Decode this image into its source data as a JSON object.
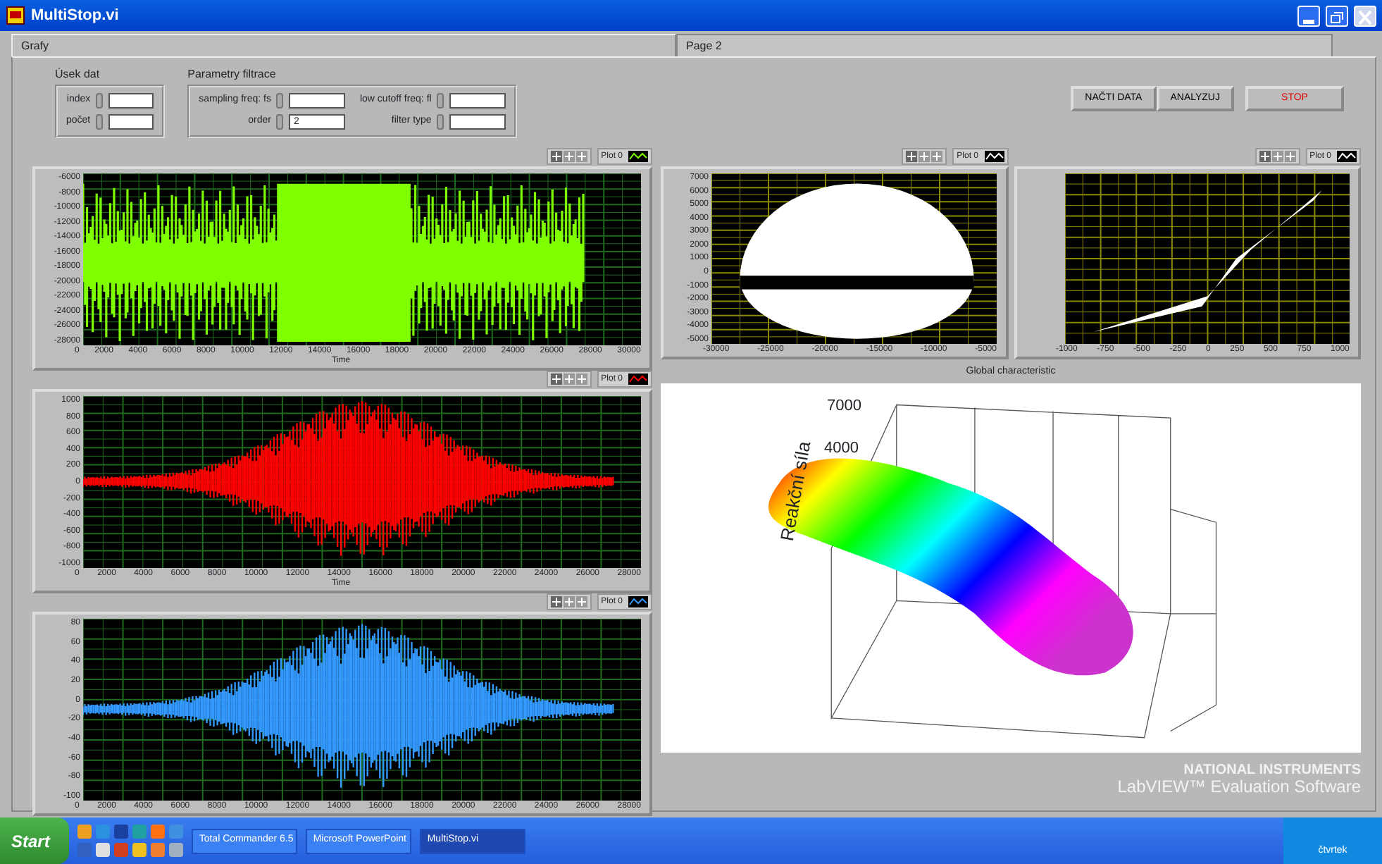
{
  "window": {
    "title": "MultiStop.vi"
  },
  "tabs": [
    {
      "label": "Grafy",
      "selected": true
    },
    {
      "label": "Page 2",
      "selected": false
    }
  ],
  "data_range": {
    "title": "Úsek dat",
    "fields": [
      {
        "label": "index"
      },
      {
        "label": "počet"
      }
    ]
  },
  "filter_params": {
    "title": "Parametry filtrace",
    "fields": [
      {
        "label": "sampling freq: fs"
      },
      {
        "label": "low cutoff freq: fl"
      },
      {
        "label": "order",
        "value": "2"
      },
      {
        "label": "filter type"
      }
    ]
  },
  "buttons": [
    {
      "label": "NAČTI DATA",
      "kind": "normal"
    },
    {
      "label": "ANALYZUJ",
      "kind": "normal"
    },
    {
      "label": "STOP",
      "kind": "stop"
    }
  ],
  "waveform_graphs": [
    {
      "legend": "Plot 0",
      "color": "#80ff00",
      "kind": "dense",
      "xlabel": "Time",
      "y_ticks": [
        "-6000",
        "-8000",
        "-10000",
        "-12000",
        "-14000",
        "-16000",
        "-18000",
        "-20000",
        "-22000",
        "-24000",
        "-26000",
        "-28000"
      ],
      "x_ticks": [
        "0",
        "2000",
        "4000",
        "6000",
        "8000",
        "10000",
        "12000",
        "14000",
        "16000",
        "18000",
        "20000",
        "22000",
        "24000",
        "26000",
        "28000",
        "30000"
      ]
    },
    {
      "legend": "Plot 0",
      "color": "#ff0000",
      "kind": "burst",
      "xlabel": "Time",
      "y_ticks": [
        "1000",
        "800",
        "600",
        "400",
        "200",
        "0",
        "-200",
        "-400",
        "-600",
        "-800",
        "-1000"
      ],
      "x_ticks": [
        "0",
        "2000",
        "4000",
        "6000",
        "8000",
        "10000",
        "12000",
        "14000",
        "16000",
        "18000",
        "20000",
        "22000",
        "24000",
        "26000",
        "28000"
      ]
    },
    {
      "legend": "Plot 0",
      "color": "#3399ff",
      "kind": "burst",
      "y_ticks": [
        "80",
        "60",
        "40",
        "20",
        "0",
        "-20",
        "-40",
        "-60",
        "-80",
        "-100"
      ],
      "x_ticks": [
        "0",
        "2000",
        "4000",
        "6000",
        "8000",
        "10000",
        "12000",
        "14000",
        "16000",
        "18000",
        "20000",
        "22000",
        "24000",
        "26000",
        "28000"
      ]
    }
  ],
  "xy_graphs": [
    {
      "legend": "Plot 0",
      "color": "#ffffff",
      "kind": "loop",
      "y_ticks": [
        "7000",
        "6000",
        "5000",
        "4000",
        "3000",
        "2000",
        "1000",
        "0",
        "-1000",
        "-2000",
        "-3000",
        "-4000",
        "-5000"
      ],
      "x_ticks": [
        "-30000",
        "-25000",
        "-20000",
        "-15000",
        "-10000",
        "-5000"
      ]
    },
    {
      "legend": "Plot 0",
      "color": "#ffffff",
      "kind": "curve",
      "x_ticks": [
        "-1000",
        "-750",
        "-500",
        "-250",
        "0",
        "250",
        "500",
        "750",
        "1000"
      ]
    }
  ],
  "surface_plot": {
    "caption": "Global characteristic",
    "axis_label": "Reakční síla",
    "z_ticks": [
      "7000",
      "4000"
    ]
  },
  "watermark": {
    "brand": "NATIONAL INSTRUMENTS",
    "product": "LabVIEW™ Evaluation Software"
  },
  "taskbar": {
    "start": "Start",
    "tasks": [
      {
        "label": "Total Commander 6.5",
        "active": false
      },
      {
        "label": "Microsoft PowerPoint",
        "active": false
      },
      {
        "label": "MultiStop.vi",
        "active": true
      }
    ],
    "clock_day": "čtvrtek"
  }
}
